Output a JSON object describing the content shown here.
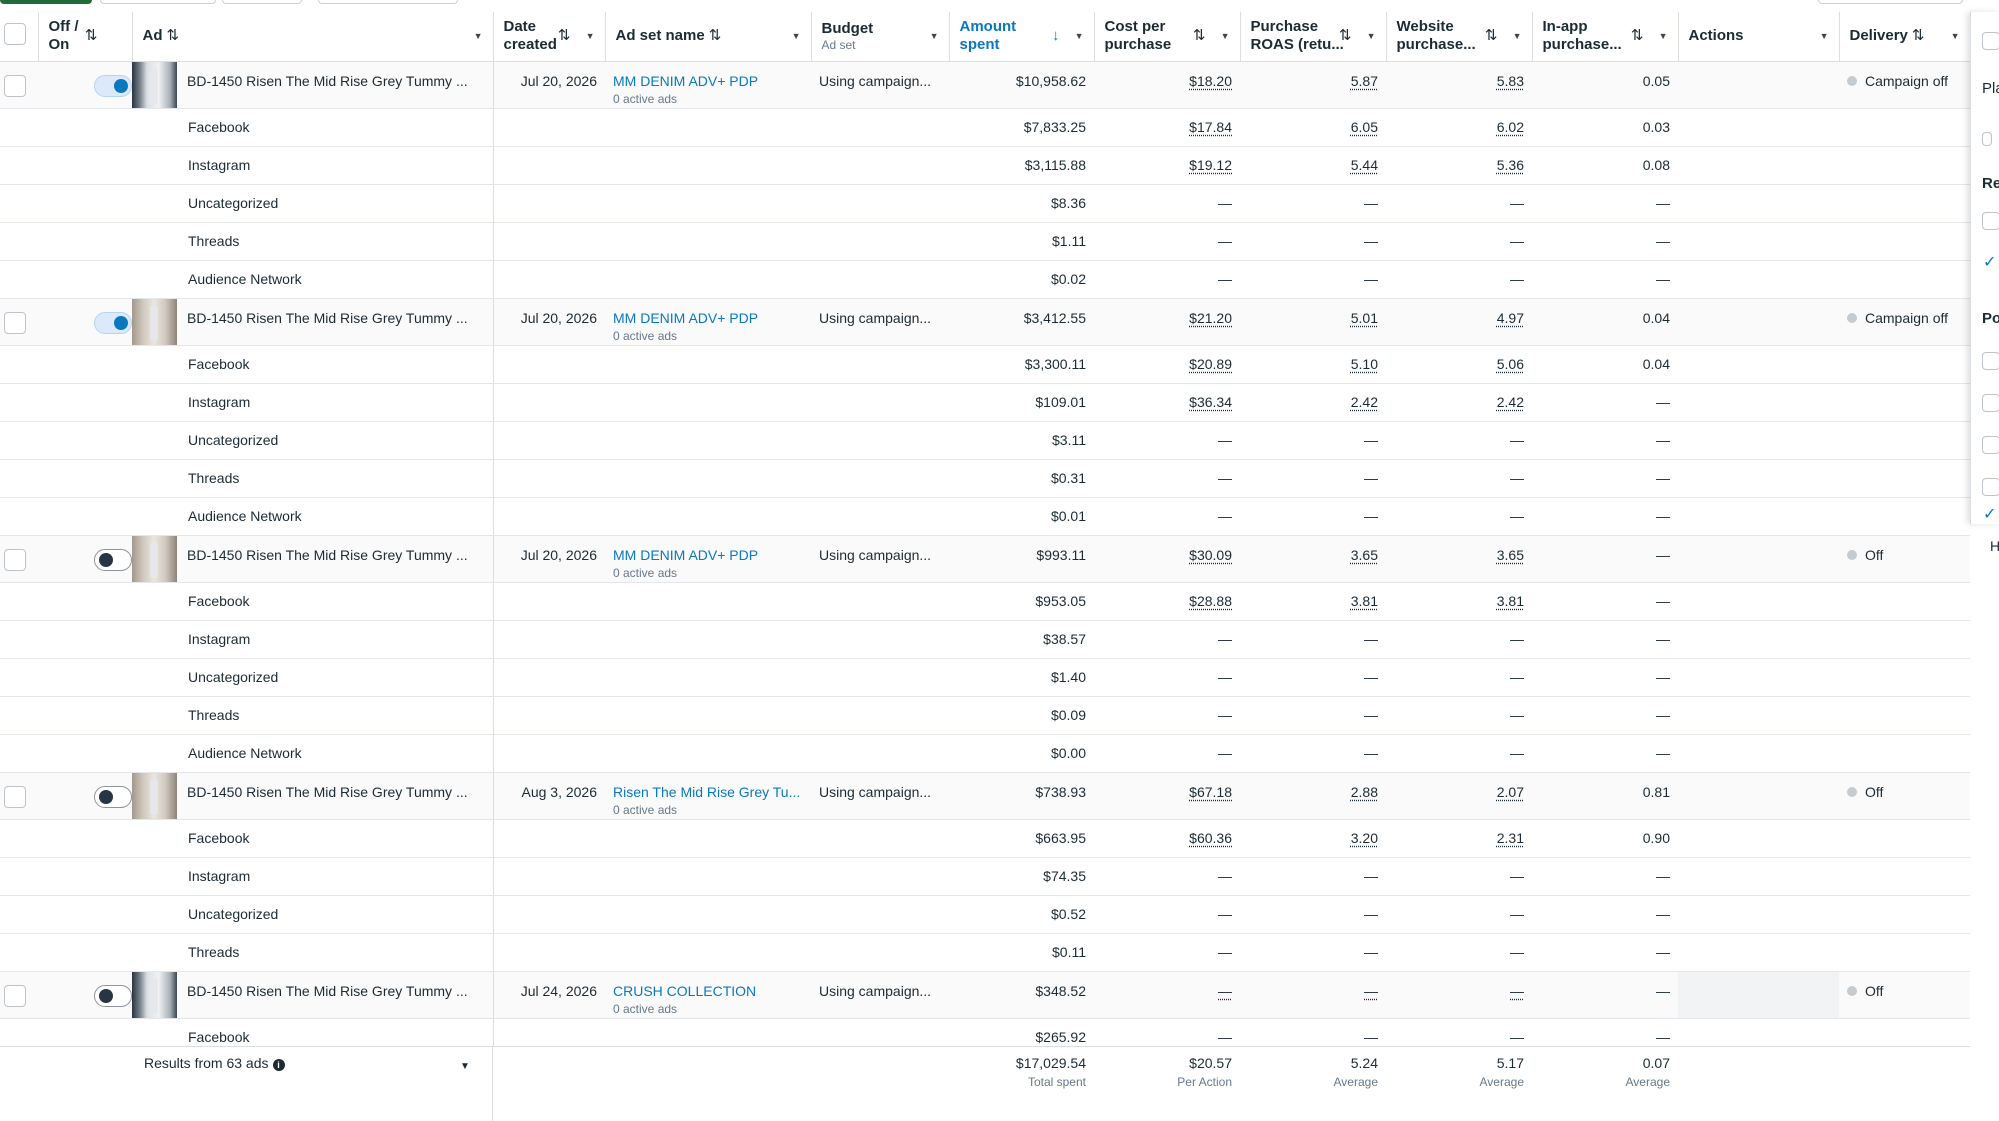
{
  "columns": {
    "offon": "Off / On",
    "ad": "Ad",
    "date": "Date created",
    "adset": "Ad set name",
    "budget": "Budget",
    "budget_sub": "Ad set",
    "amount": "Amount spent",
    "cpp": "Cost per purchase",
    "roas": "Purchase ROAS (retu...",
    "website": "Website purchase...",
    "inapp": "In-app purchase...",
    "actions": "Actions",
    "delivery": "Delivery"
  },
  "ads": [
    {
      "name": "BD-1450 Risen The Mid Rise Grey Tummy ...",
      "date": "Jul 20, 2026",
      "adset": "MM DENIM ADV+ PDP",
      "adset_note": "0 active ads",
      "budget": "Using campaign...",
      "amount": "$10,958.62",
      "cpp": "$18.20",
      "roas": "5.87",
      "website": "5.83",
      "inapp": "0.05",
      "delivery": "Campaign off",
      "toggle_on": true,
      "rows": [
        {
          "label": "Facebook",
          "amount": "$7,833.25",
          "cpp": "$17.84",
          "roas": "6.05",
          "website": "6.02",
          "inapp": "0.03"
        },
        {
          "label": "Instagram",
          "amount": "$3,115.88",
          "cpp": "$19.12",
          "roas": "5.44",
          "website": "5.36",
          "inapp": "0.08"
        },
        {
          "label": "Uncategorized",
          "amount": "$8.36",
          "cpp": "—",
          "roas": "—",
          "website": "—",
          "inapp": "—"
        },
        {
          "label": "Threads",
          "amount": "$1.11",
          "cpp": "—",
          "roas": "—",
          "website": "—",
          "inapp": "—"
        },
        {
          "label": "Audience Network",
          "amount": "$0.02",
          "cpp": "—",
          "roas": "—",
          "website": "—",
          "inapp": "—"
        }
      ]
    },
    {
      "name": "BD-1450 Risen The Mid Rise Grey Tummy ...",
      "date": "Jul 20, 2026",
      "adset": "MM DENIM ADV+ PDP",
      "adset_note": "0 active ads",
      "budget": "Using campaign...",
      "amount": "$3,412.55",
      "cpp": "$21.20",
      "roas": "5.01",
      "website": "4.97",
      "inapp": "0.04",
      "delivery": "Campaign off",
      "toggle_on": true,
      "rows": [
        {
          "label": "Facebook",
          "amount": "$3,300.11",
          "cpp": "$20.89",
          "roas": "5.10",
          "website": "5.06",
          "inapp": "0.04"
        },
        {
          "label": "Instagram",
          "amount": "$109.01",
          "cpp": "$36.34",
          "roas": "2.42",
          "website": "2.42",
          "inapp": "—"
        },
        {
          "label": "Uncategorized",
          "amount": "$3.11",
          "cpp": "—",
          "roas": "—",
          "website": "—",
          "inapp": "—"
        },
        {
          "label": "Threads",
          "amount": "$0.31",
          "cpp": "—",
          "roas": "—",
          "website": "—",
          "inapp": "—"
        },
        {
          "label": "Audience Network",
          "amount": "$0.01",
          "cpp": "—",
          "roas": "—",
          "website": "—",
          "inapp": "—"
        }
      ]
    },
    {
      "name": "BD-1450 Risen The Mid Rise Grey Tummy ...",
      "date": "Jul 20, 2026",
      "adset": "MM DENIM ADV+ PDP",
      "adset_note": "0 active ads",
      "budget": "Using campaign...",
      "amount": "$993.11",
      "cpp": "$30.09",
      "roas": "3.65",
      "website": "3.65",
      "inapp": "—",
      "delivery": "Off",
      "toggle_on": false,
      "rows": [
        {
          "label": "Facebook",
          "amount": "$953.05",
          "cpp": "$28.88",
          "roas": "3.81",
          "website": "3.81",
          "inapp": "—"
        },
        {
          "label": "Instagram",
          "amount": "$38.57",
          "cpp": "—",
          "roas": "—",
          "website": "—",
          "inapp": "—"
        },
        {
          "label": "Uncategorized",
          "amount": "$1.40",
          "cpp": "—",
          "roas": "—",
          "website": "—",
          "inapp": "—"
        },
        {
          "label": "Threads",
          "amount": "$0.09",
          "cpp": "—",
          "roas": "—",
          "website": "—",
          "inapp": "—"
        },
        {
          "label": "Audience Network",
          "amount": "$0.00",
          "cpp": "—",
          "roas": "—",
          "website": "—",
          "inapp": "—"
        }
      ]
    },
    {
      "name": "BD-1450 Risen The Mid Rise Grey Tummy ...",
      "date": "Aug 3, 2026",
      "adset": "Risen The Mid Rise Grey Tu...",
      "adset_note": "0 active ads",
      "budget": "Using campaign...",
      "amount": "$738.93",
      "cpp": "$67.18",
      "roas": "2.88",
      "website": "2.07",
      "inapp": "0.81",
      "delivery": "Off",
      "toggle_on": false,
      "rows": [
        {
          "label": "Facebook",
          "amount": "$663.95",
          "cpp": "$60.36",
          "roas": "3.20",
          "website": "2.31",
          "inapp": "0.90"
        },
        {
          "label": "Instagram",
          "amount": "$74.35",
          "cpp": "—",
          "roas": "—",
          "website": "—",
          "inapp": "—"
        },
        {
          "label": "Uncategorized",
          "amount": "$0.52",
          "cpp": "—",
          "roas": "—",
          "website": "—",
          "inapp": "—"
        },
        {
          "label": "Threads",
          "amount": "$0.11",
          "cpp": "—",
          "roas": "—",
          "website": "—",
          "inapp": "—"
        }
      ]
    },
    {
      "name": "BD-1450 Risen The Mid Rise Grey Tummy ...",
      "date": "Jul 24, 2026",
      "adset": "CRUSH COLLECTION",
      "adset_note": "0 active ads",
      "budget": "Using campaign...",
      "amount": "$348.52",
      "cpp": "—",
      "roas": "—",
      "website": "—",
      "inapp": "—",
      "delivery": "Off",
      "toggle_on": false,
      "rows": [
        {
          "label": "Facebook",
          "amount": "$265.92",
          "cpp": "—",
          "roas": "—",
          "website": "—",
          "inapp": "—"
        }
      ]
    }
  ],
  "footer": {
    "results": "Results from 63 ads",
    "total": "$17,029.54",
    "total_label": "Total spent",
    "cpp": "$20.57",
    "cpp_label": "Per Action",
    "roas": "5.24",
    "roas_label": "Average",
    "website": "5.17",
    "website_label": "Average",
    "inapp": "0.07",
    "inapp_label": "Average"
  },
  "side_panel": {
    "label_1": "Pla",
    "label_2": "Re",
    "label_3": "Po",
    "hint": "H"
  }
}
